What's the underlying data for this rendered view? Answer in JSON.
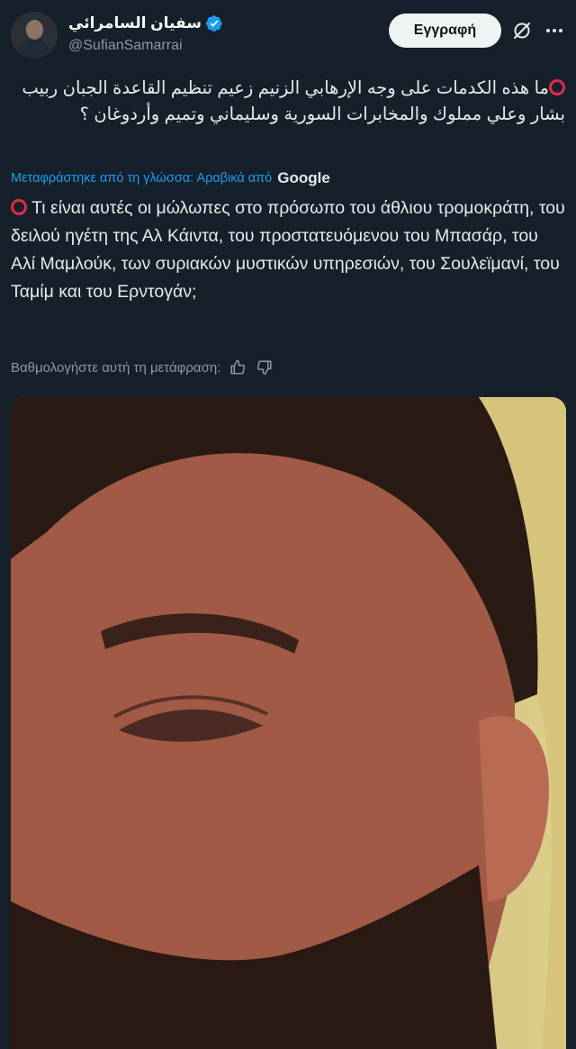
{
  "author": {
    "display_name": "سفيان السامرائي",
    "handle": "@SufianSamarrai",
    "verified": true
  },
  "header": {
    "subscribe_label": "Εγγραφή"
  },
  "tweet": {
    "original_text": "ما هذه الكدمات على وجه الإرهابي الزنيم زعيم تنظيم القاعدة الجبان ربيب بشار وعلي مملوك والمخابرات السورية وسليماني وتميم وأردوغان ؟",
    "translation_note": "Μεταφράστηκε από τη γλώσσα: Αραβικά από",
    "translation_provider": "Google",
    "translated_text": "Τι είναι αυτές οι μώλωπες στο πρόσωπο του άθλιου τρομοκράτη, του δειλού ηγέτη της Αλ Κάιντα, του προστατευόμενου του Μπασάρ, του Αλί Μαμλούκ, των συριακών μυστικών υπηρεσιών, του Σουλεϊμανί, του Ταμίμ και του Ερντογάν;",
    "rate_prompt": "Βαθμολογήστε αυτή τη μετάφραση:"
  },
  "icons": {
    "verified": "verified-badge-icon",
    "grok": "grok-icon",
    "more": "more-dots-icon",
    "thumbs_up": "thumbs-up-icon",
    "thumbs_down": "thumbs-down-icon",
    "marker": "red-circle-icon"
  },
  "colors": {
    "background": "#15202b",
    "accent": "#1d9bf0",
    "marker": "#e02a4a"
  }
}
